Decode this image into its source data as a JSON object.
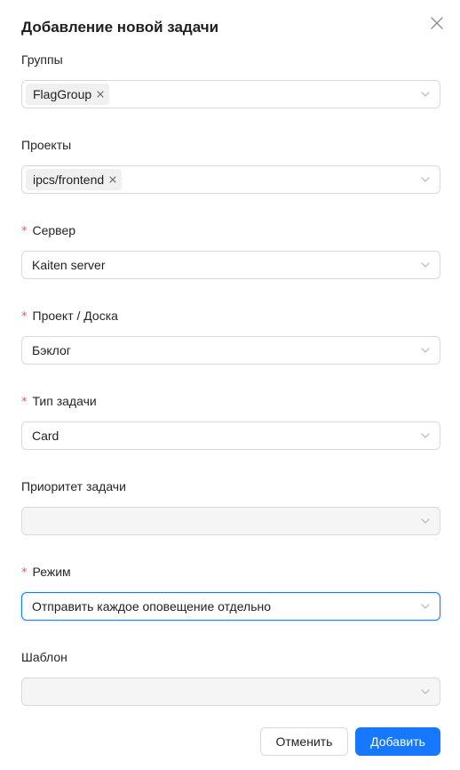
{
  "modal": {
    "title": "Добавление новой задачи",
    "close_icon": "close-icon"
  },
  "fields": {
    "groups": {
      "label": "Группы",
      "required": false,
      "tags": [
        "FlagGroup"
      ]
    },
    "projects": {
      "label": "Проекты",
      "required": false,
      "tags": [
        "ipcs/frontend"
      ]
    },
    "server": {
      "label": "Сервер",
      "required": true,
      "value": "Kaiten server"
    },
    "board": {
      "label": "Проект / Доска",
      "required": true,
      "value": "Бэклог"
    },
    "task_type": {
      "label": "Тип задачи",
      "required": true,
      "value": "Card"
    },
    "priority": {
      "label": "Приоритет задачи",
      "required": false,
      "value": "",
      "disabled": true
    },
    "mode": {
      "label": "Режим",
      "required": true,
      "value": "Отправить каждое оповещение отдельно",
      "focused": true
    },
    "template": {
      "label": "Шаблон",
      "required": false,
      "value": "",
      "disabled": true
    }
  },
  "required_mark": "*",
  "footer": {
    "cancel_label": "Отменить",
    "submit_label": "Добавить"
  },
  "colors": {
    "primary": "#1677ff",
    "required": "#ff4d4f",
    "border": "#d9d9d9",
    "disabled_bg": "#f5f5f5",
    "tag_bg": "#f0f0f0"
  }
}
